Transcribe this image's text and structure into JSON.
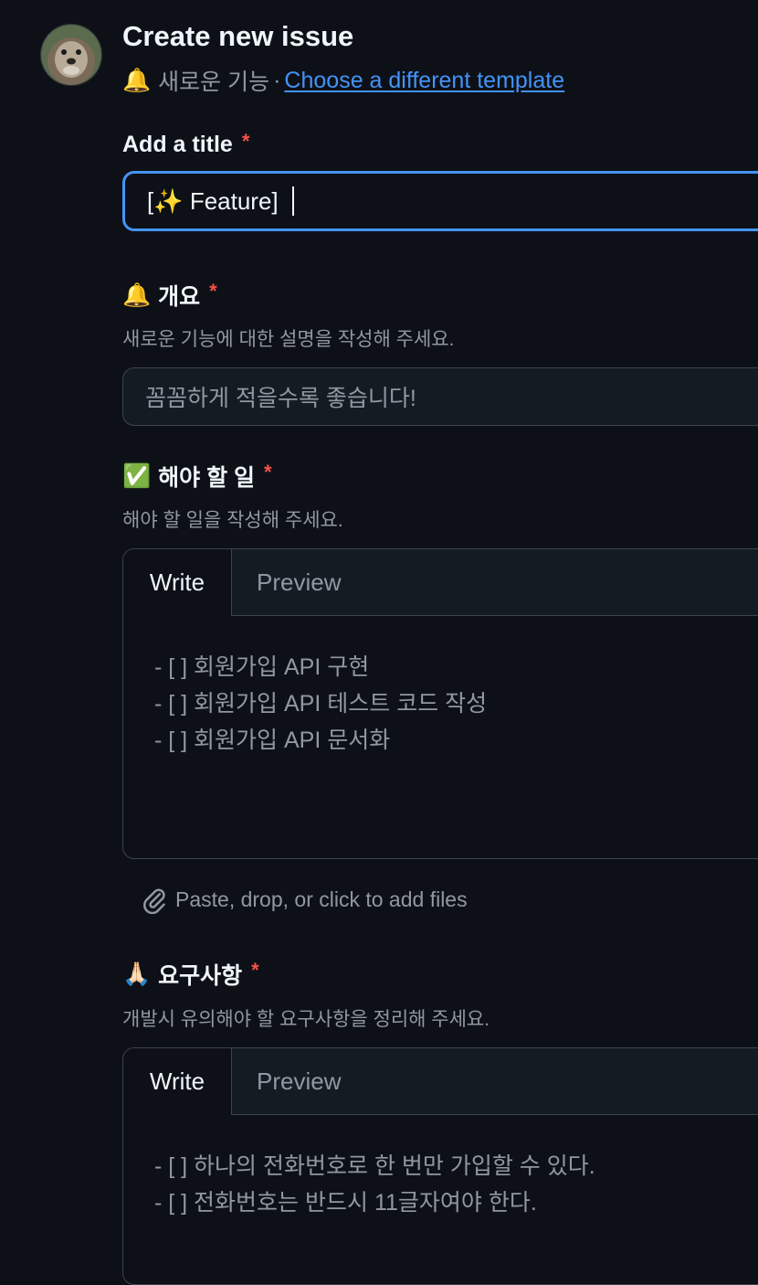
{
  "header": {
    "title": "Create new issue",
    "template_emoji": "🔔",
    "template_name": "새로운 기능",
    "separator": "·",
    "change_template_link": "Choose a different template"
  },
  "title_field": {
    "label": "Add a title",
    "required_mark": "*",
    "value": "[✨ Feature] "
  },
  "summary_field": {
    "label_emoji": "🔔",
    "label": "개요",
    "required_mark": "*",
    "description": "새로운 기능에 대한 설명을 작성해 주세요.",
    "placeholder": "꼼꼼하게 적을수록 좋습니다!"
  },
  "todo_field": {
    "label_emoji": "✅",
    "label": "해야 할 일",
    "required_mark": "*",
    "description": "해야 할 일을 작성해 주세요.",
    "tab_write": "Write",
    "tab_preview": "Preview",
    "content": "- [ ] 회원가입 API 구현\n- [ ] 회원가입 API 테스트 코드 작성\n- [ ] 회원가입 API 문서화",
    "attach_text": "Paste, drop, or click to add files"
  },
  "requirements_field": {
    "label_emoji": "🙏🏻",
    "label": "요구사항",
    "required_mark": "*",
    "description": "개발시 유의해야 할 요구사항을 정리해 주세요.",
    "tab_write": "Write",
    "tab_preview": "Preview",
    "content": "- [ ] 하나의 전화번호로 한 번만 가입할 수 있다.\n- [ ] 전화번호는 반드시 11글자여야 한다."
  },
  "colors": {
    "background": "#0d1117",
    "accent": "#4493f8",
    "required": "#f85149"
  }
}
